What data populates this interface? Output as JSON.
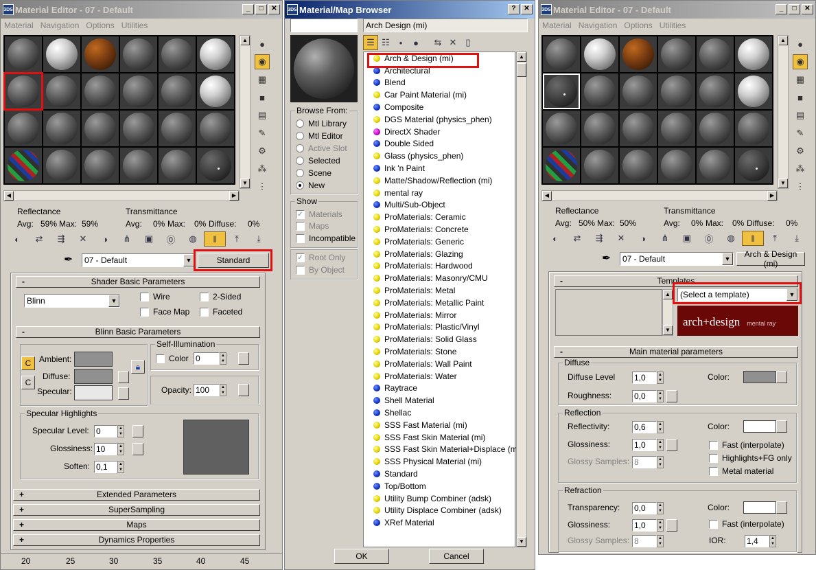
{
  "window1": {
    "title": "Material Editor - 07 - Default",
    "menu": [
      "Material",
      "Navigation",
      "Options",
      "Utilities"
    ],
    "reflectance_label": "Reflectance",
    "transmittance_label": "Transmittance",
    "avg_label": "Avg:",
    "avg_val": "59%",
    "max_label": "Max:",
    "max_val": "59%",
    "t_avg_label": "Avg:",
    "t_avg_val": "0%",
    "t_max_label": "Max:",
    "t_max_val": "0%",
    "diffuse_label": "Diffuse:",
    "diffuse_val": "0%",
    "material_name": "07 - Default",
    "type_button": "Standard",
    "shader_rollout": "Shader Basic Parameters",
    "shader_type": "Blinn",
    "wire": "Wire",
    "two_sided": "2-Sided",
    "face_map": "Face Map",
    "faceted": "Faceted",
    "blinn_rollout": "Blinn Basic Parameters",
    "self_illum": "Self-Illumination",
    "color_label": "Color",
    "color_val": "0",
    "ambient": "Ambient:",
    "diffuse": "Diffuse:",
    "specular": "Specular:",
    "opacity_label": "Opacity:",
    "opacity_val": "100",
    "spec_highlights": "Specular Highlights",
    "spec_level": "Specular Level:",
    "spec_level_val": "0",
    "glossiness": "Glossiness:",
    "glossiness_val": "10",
    "soften": "Soften:",
    "soften_val": "0,1",
    "rollouts": [
      "Extended Parameters",
      "SuperSampling",
      "Maps",
      "Dynamics Properties"
    ],
    "ruler": [
      "20",
      "25",
      "30",
      "35",
      "40",
      "45"
    ]
  },
  "window2": {
    "title": "Material/Map Browser",
    "name_field": "Arch  Design (mi)",
    "browse_from": "Browse From:",
    "browse_options": [
      "Mtl Library",
      "Mtl Editor",
      "Active Slot",
      "Selected",
      "Scene",
      "New"
    ],
    "show": "Show",
    "show_options": [
      "Materials",
      "Maps",
      "Incompatible"
    ],
    "root_only": "Root Only",
    "by_object": "By Object",
    "ok": "OK",
    "cancel": "Cancel",
    "items": [
      {
        "label": "Arch & Design (mi)",
        "color": "y"
      },
      {
        "label": "Architectural",
        "color": "b"
      },
      {
        "label": "Blend",
        "color": "b"
      },
      {
        "label": "Car Paint Material (mi)",
        "color": "y"
      },
      {
        "label": "Composite",
        "color": "b"
      },
      {
        "label": "DGS Material (physics_phen)",
        "color": "y"
      },
      {
        "label": "DirectX Shader",
        "color": "m"
      },
      {
        "label": "Double Sided",
        "color": "b"
      },
      {
        "label": "Glass (physics_phen)",
        "color": "y"
      },
      {
        "label": "Ink 'n Paint",
        "color": "b"
      },
      {
        "label": "Matte/Shadow/Reflection (mi)",
        "color": "y"
      },
      {
        "label": "mental ray",
        "color": "y"
      },
      {
        "label": "Multi/Sub-Object",
        "color": "b"
      },
      {
        "label": "ProMaterials: Ceramic",
        "color": "y"
      },
      {
        "label": "ProMaterials: Concrete",
        "color": "y"
      },
      {
        "label": "ProMaterials: Generic",
        "color": "y"
      },
      {
        "label": "ProMaterials: Glazing",
        "color": "y"
      },
      {
        "label": "ProMaterials: Hardwood",
        "color": "y"
      },
      {
        "label": "ProMaterials: Masonry/CMU",
        "color": "y"
      },
      {
        "label": "ProMaterials: Metal",
        "color": "y"
      },
      {
        "label": "ProMaterials: Metallic Paint",
        "color": "y"
      },
      {
        "label": "ProMaterials: Mirror",
        "color": "y"
      },
      {
        "label": "ProMaterials: Plastic/Vinyl",
        "color": "y"
      },
      {
        "label": "ProMaterials: Solid Glass",
        "color": "y"
      },
      {
        "label": "ProMaterials: Stone",
        "color": "y"
      },
      {
        "label": "ProMaterials: Wall Paint",
        "color": "y"
      },
      {
        "label": "ProMaterials: Water",
        "color": "y"
      },
      {
        "label": "Raytrace",
        "color": "b"
      },
      {
        "label": "Shell Material",
        "color": "b"
      },
      {
        "label": "Shellac",
        "color": "b"
      },
      {
        "label": "SSS Fast Material (mi)",
        "color": "y"
      },
      {
        "label": "SSS Fast Skin Material (mi)",
        "color": "y"
      },
      {
        "label": "SSS Fast Skin Material+Displace (mi",
        "color": "y"
      },
      {
        "label": "SSS Physical Material (mi)",
        "color": "y"
      },
      {
        "label": "Standard",
        "color": "b"
      },
      {
        "label": "Top/Bottom",
        "color": "b"
      },
      {
        "label": "Utility Bump Combiner (adsk)",
        "color": "y"
      },
      {
        "label": "Utility Displace Combiner (adsk)",
        "color": "y"
      },
      {
        "label": "XRef Material",
        "color": "b"
      }
    ]
  },
  "window3": {
    "title": "Material Editor - 07 - Default",
    "menu": [
      "Material",
      "Navigation",
      "Options",
      "Utilities"
    ],
    "reflectance_label": "Reflectance",
    "transmittance_label": "Transmittance",
    "avg_label": "Avg:",
    "avg_val": "50%",
    "max_label": "Max:",
    "max_val": "50%",
    "t_avg_label": "Avg:",
    "t_avg_val": "0%",
    "t_max_label": "Max:",
    "t_max_val": "0%",
    "diffuse_label": "Diffuse:",
    "diffuse_val": "0%",
    "material_name": "07 - Default",
    "type_button": "Arch & Design (mi)",
    "templates_rollout": "Templates",
    "template_select": "(Select a template)",
    "logo_main": "arch+design",
    "logo_sub": "mental ray",
    "main_rollout": "Main material parameters",
    "diffuse_grp": "Diffuse",
    "diffuse_level": "Diffuse Level",
    "diffuse_level_val": "1,0",
    "color_label": "Color:",
    "roughness": "Roughness:",
    "roughness_val": "0,0",
    "reflection_grp": "Reflection",
    "reflectivity": "Reflectivity:",
    "reflectivity_val": "0,6",
    "glossiness": "Glossiness:",
    "glossiness_val": "1,0",
    "glossy_samples": "Glossy Samples:",
    "glossy_samples_val": "8",
    "fast_interp": "Fast (interpolate)",
    "highlights_fg": "Highlights+FG only",
    "metal_material": "Metal material",
    "refraction_grp": "Refraction",
    "transparency": "Transparency:",
    "transparency_val": "0,0",
    "r_glossiness": "Glossiness:",
    "r_glossiness_val": "1,0",
    "r_glossy_samples": "Glossy Samples:",
    "r_glossy_samples_val": "8",
    "r_fast_interp": "Fast (interpolate)",
    "ior": "IOR:",
    "ior_val": "1,4"
  },
  "colors": {
    "highlight_red": "#e01010",
    "title_blue": "#0a246a",
    "face": "#d4d0c8"
  }
}
